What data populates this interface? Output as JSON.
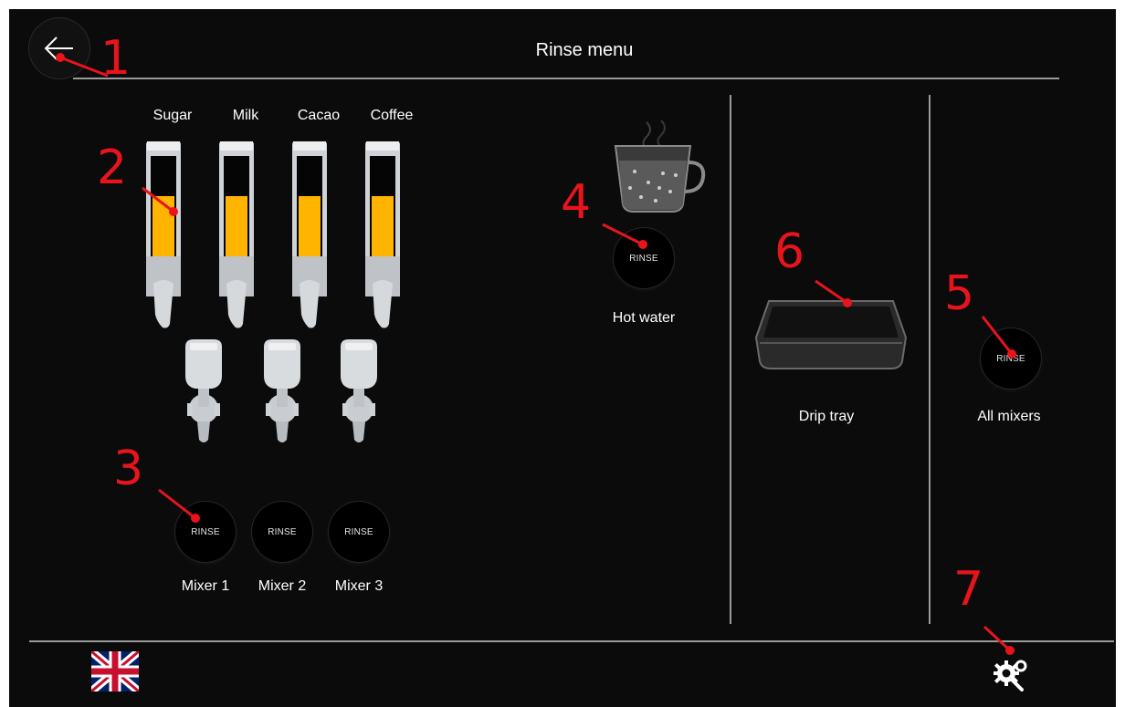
{
  "header": {
    "title": "Rinse menu"
  },
  "canisters": [
    {
      "label": "Sugar",
      "fill_fraction": 0.6
    },
    {
      "label": "Milk",
      "fill_fraction": 0.6
    },
    {
      "label": "Cacao",
      "fill_fraction": 0.6
    },
    {
      "label": "Coffee",
      "fill_fraction": 0.6
    }
  ],
  "mixers": [
    {
      "button_label": "RINSE",
      "label": "Mixer 1"
    },
    {
      "button_label": "RINSE",
      "label": "Mixer 2"
    },
    {
      "button_label": "RINSE",
      "label": "Mixer 3"
    }
  ],
  "hot_water": {
    "button_label": "RINSE",
    "label": "Hot water"
  },
  "drip_tray": {
    "label": "Drip tray"
  },
  "all_mixers": {
    "button_label": "RINSE",
    "label": "All mixers"
  },
  "markers": [
    "1",
    "2",
    "3",
    "4",
    "5",
    "6",
    "7"
  ],
  "footer": {
    "language_icon": "uk-flag-icon",
    "settings_icon": "settings-gear-wrench-icon"
  },
  "colors": {
    "background": "#0b0b0b",
    "ingredient_fill": "#ffb400",
    "annotation": "#e8141c",
    "divider": "#9a9a9a"
  }
}
